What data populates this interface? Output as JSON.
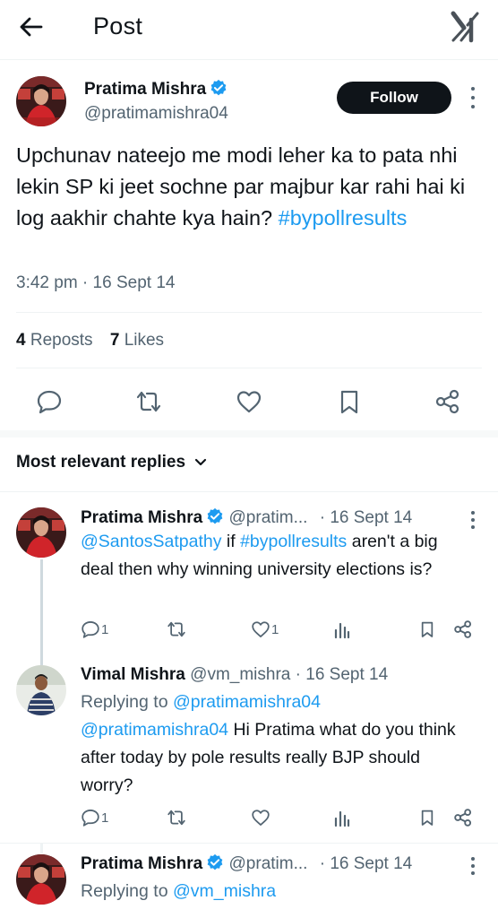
{
  "header": {
    "title": "Post",
    "back_icon": "arrow-left-icon",
    "logo_icon": "x-logo-icon"
  },
  "tweet": {
    "author_name": "Pratima Mishra",
    "handle": "@pratimamishra04",
    "follow_label": "Follow",
    "text": "Upchunav nateejo me modi leher ka to pata nhi lekin SP ki jeet sochne par majbur kar rahi hai ki log aakhir chahte kya hain?",
    "hashtag": "#bypollresults",
    "time": "3:42 pm · 16 Sept 14",
    "reposts_count": "4",
    "reposts_label": "Reposts",
    "likes_count": "7",
    "likes_label": "Likes"
  },
  "replies_section": {
    "title": "Most relevant replies"
  },
  "replies": [
    {
      "author_name": "Pratima Mishra",
      "handle": "@pratim...",
      "date": "· 16 Sept 14",
      "mention": "@SantosSatpathy",
      "text_a": " if ",
      "hashtag": "#bypollresults",
      "text_b": " aren't a big deal then why winning university elections is?",
      "reply_count": "1",
      "like_count": "1"
    },
    {
      "author_name": "Vimal Mishra",
      "handle": "@vm_mishra",
      "date": "· 16 Sept 14",
      "replying_label": "Replying to",
      "replying_to": "@pratimamishra04",
      "mention": "@pratimamishra04",
      "text": " Hi Pratima what do you think after today by pole results really BJP should worry?",
      "reply_count": "1"
    },
    {
      "author_name": "Pratima Mishra",
      "handle": "@pratim...",
      "date": "· 16 Sept 14",
      "replying_label": "Replying to",
      "replying_to": "@vm_mishra"
    }
  ],
  "colors": {
    "accent": "#1d9bf0",
    "text": "#0f1419",
    "muted": "#536471",
    "divider": "#eff3f4"
  }
}
